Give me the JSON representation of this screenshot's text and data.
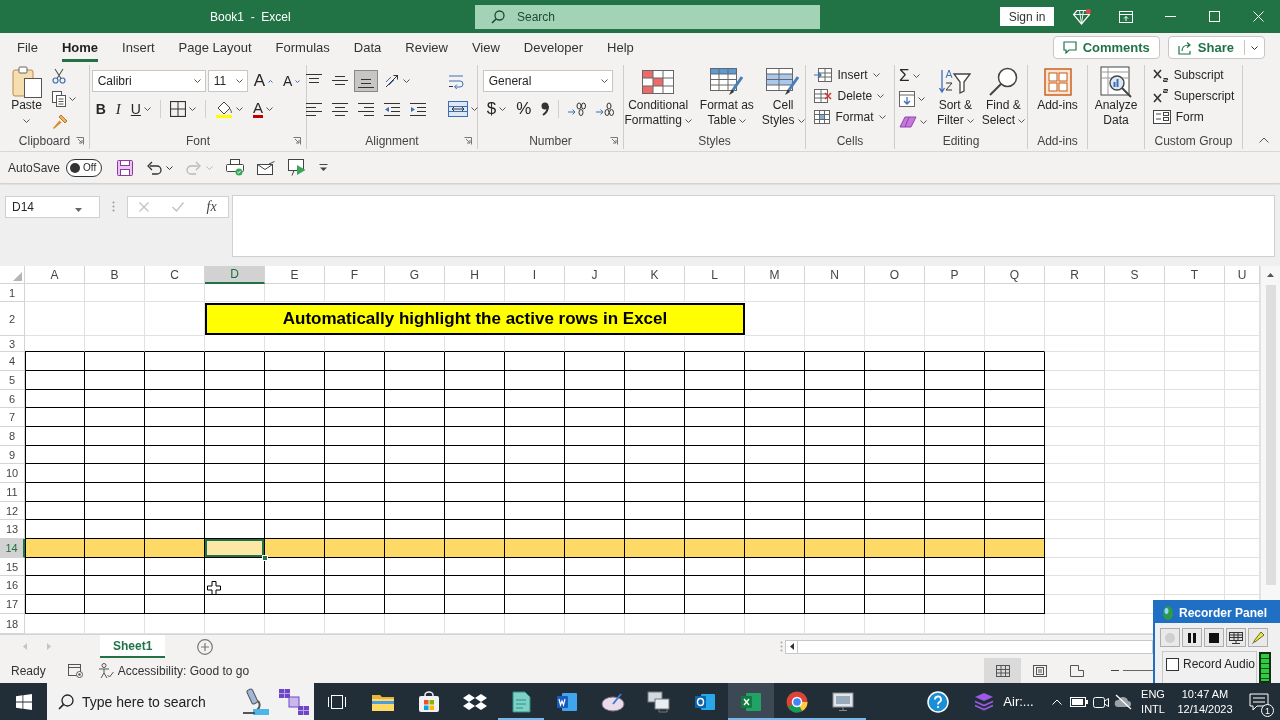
{
  "window": {
    "title": "Book1  -  Excel",
    "search": {
      "placeholder": "Search"
    },
    "sign_in": "Sign in"
  },
  "menu": {
    "tabs": [
      {
        "label": "File",
        "selected": false
      },
      {
        "label": "Home",
        "selected": true
      },
      {
        "label": "Insert",
        "selected": false
      },
      {
        "label": "Page Layout",
        "selected": false
      },
      {
        "label": "Formulas",
        "selected": false
      },
      {
        "label": "Data",
        "selected": false
      },
      {
        "label": "Review",
        "selected": false
      },
      {
        "label": "View",
        "selected": false
      },
      {
        "label": "Developer",
        "selected": false
      },
      {
        "label": "Help",
        "selected": false
      }
    ],
    "comments": "Comments",
    "share": "Share"
  },
  "ribbon": {
    "groups": [
      {
        "label": "Clipboard",
        "launcher": true,
        "items": [
          {
            "kind": "large",
            "lines": [
              "Paste"
            ],
            "dropdown": true
          },
          {
            "kind": "icon",
            "dropdown": false
          },
          {
            "kind": "icon",
            "dropdown": true
          },
          {
            "kind": "icon",
            "dropdown": false
          }
        ]
      },
      {
        "label": "Font",
        "launcher": true,
        "items": [
          {
            "kind": "combo",
            "value": "Calibri",
            "dropdown": true
          },
          {
            "kind": "combo",
            "value": "11",
            "dropdown": true
          },
          {
            "kind": "glyph",
            "label": "A",
            "dropdown": false
          },
          {
            "kind": "glyph",
            "label": "A",
            "dropdown": false
          },
          {
            "kind": "icon",
            "dropdown": true
          },
          {
            "kind": "icon",
            "dropdown": true
          },
          {
            "kind": "glyph",
            "label": "A",
            "dropdown": true
          }
        ],
        "toggles": [
          {
            "label": "B",
            "on": false,
            "dropdown": false
          },
          {
            "label": "I",
            "on": false,
            "dropdown": false
          },
          {
            "label": "U",
            "on": false,
            "dropdown": true
          }
        ]
      },
      {
        "label": "Alignment",
        "launcher": true,
        "items": [
          {
            "kind": "icon",
            "dropdown": true
          },
          {
            "kind": "icon",
            "dropdown": false
          },
          {
            "kind": "icon",
            "dropdown": false
          },
          {
            "kind": "icon",
            "dropdown": false
          },
          {
            "kind": "icon",
            "dropdown": true
          }
        ],
        "toggles": [
          {
            "on": false,
            "dropdown": false
          },
          {
            "on": false,
            "dropdown": false
          },
          {
            "on": true,
            "dropdown": false
          },
          {
            "on": false,
            "dropdown": false
          },
          {
            "on": false,
            "dropdown": false
          },
          {
            "on": false,
            "dropdown": false
          }
        ]
      },
      {
        "label": "Number",
        "launcher": true,
        "items": [
          {
            "kind": "combo",
            "value": "General",
            "dropdown": true
          },
          {
            "kind": "glyph",
            "label": "$",
            "dropdown": true
          },
          {
            "kind": "glyph",
            "label": "%",
            "dropdown": false
          },
          {
            "kind": "icon",
            "dropdown": false
          },
          {
            "kind": "icon",
            "dropdown": false
          },
          {
            "kind": "icon",
            "dropdown": false
          }
        ]
      },
      {
        "label": "Styles",
        "launcher": false,
        "items": [
          {
            "kind": "large",
            "lines": [
              "Conditional",
              "Formatting"
            ],
            "dropdown": true
          },
          {
            "kind": "large",
            "lines": [
              "Format as",
              "Table"
            ],
            "dropdown": true
          },
          {
            "kind": "large",
            "lines": [
              "Cell",
              "Styles"
            ],
            "dropdown": true
          }
        ]
      },
      {
        "label": "Cells",
        "launcher": false,
        "items": [
          {
            "kind": "small",
            "label": "Insert",
            "dropdown": true
          },
          {
            "kind": "small",
            "label": "Delete",
            "dropdown": true
          },
          {
            "kind": "small",
            "label": "Format",
            "dropdown": true
          }
        ]
      },
      {
        "label": "Editing",
        "launcher": false,
        "items": [
          {
            "kind": "glyph",
            "label": "Σ",
            "dropdown": true
          },
          {
            "kind": "icon",
            "dropdown": true
          },
          {
            "kind": "icon",
            "dropdown": true
          },
          {
            "kind": "large",
            "lines": [
              "Sort &",
              "Filter"
            ],
            "dropdown": true
          },
          {
            "kind": "large",
            "lines": [
              "Find &",
              "Select"
            ],
            "dropdown": true
          }
        ]
      },
      {
        "label": "Add-ins",
        "launcher": false,
        "items": [
          {
            "kind": "large",
            "lines": [
              "Add-ins"
            ],
            "dropdown": false
          }
        ]
      },
      {
        "launcher": false,
        "items": [
          {
            "kind": "large",
            "lines": [
              "Analyze",
              "Data"
            ],
            "dropdown": false
          }
        ]
      },
      {
        "label": "Custom Group",
        "launcher": false,
        "items": [
          {
            "kind": "small",
            "label": "Subscript",
            "dropdown": false
          },
          {
            "kind": "small",
            "label": "Superscript",
            "dropdown": false
          },
          {
            "kind": "small",
            "label": "Form",
            "dropdown": false
          }
        ]
      }
    ]
  },
  "quick_access": {
    "autosave": {
      "label": "AutoSave",
      "state": "Off",
      "on": false
    },
    "history": [
      {
        "disabled": false
      },
      {
        "disabled": true
      }
    ]
  },
  "formula_bar": {
    "name_box": "D14",
    "function_label": "fx",
    "editing": false
  },
  "sheet": {
    "columns": [
      {
        "label": "A",
        "selected": false,
        "in_table": true
      },
      {
        "label": "B",
        "selected": false,
        "in_table": true
      },
      {
        "label": "C",
        "selected": false,
        "in_table": true
      },
      {
        "label": "D",
        "selected": true,
        "in_table": true
      },
      {
        "label": "E",
        "selected": false,
        "in_table": true
      },
      {
        "label": "F",
        "selected": false,
        "in_table": true
      },
      {
        "label": "G",
        "selected": false,
        "in_table": true
      },
      {
        "label": "H",
        "selected": false,
        "in_table": true
      },
      {
        "label": "I",
        "selected": false,
        "in_table": true
      },
      {
        "label": "J",
        "selected": false,
        "in_table": true
      },
      {
        "label": "K",
        "selected": false,
        "in_table": true
      },
      {
        "label": "L",
        "selected": false,
        "in_table": true
      },
      {
        "label": "M",
        "selected": false,
        "in_table": true
      },
      {
        "label": "N",
        "selected": false,
        "in_table": true
      },
      {
        "label": "O",
        "selected": false,
        "in_table": true
      },
      {
        "label": "P",
        "selected": false,
        "in_table": true
      },
      {
        "label": "Q",
        "selected": false,
        "in_table": true
      },
      {
        "label": "R",
        "selected": false,
        "in_table": false
      },
      {
        "label": "S",
        "selected": false,
        "in_table": false
      },
      {
        "label": "T",
        "selected": false,
        "in_table": false
      },
      {
        "label": "U",
        "selected": false,
        "in_table": false
      }
    ],
    "rows": [
      {
        "label": "1",
        "selected": false,
        "in_table": false,
        "highlighted": false
      },
      {
        "label": "2",
        "selected": false,
        "in_table": false,
        "highlighted": false
      },
      {
        "label": "3",
        "selected": false,
        "in_table": false,
        "highlighted": false
      },
      {
        "label": "4",
        "selected": false,
        "in_table": true,
        "highlighted": false
      },
      {
        "label": "5",
        "selected": false,
        "in_table": true,
        "highlighted": false
      },
      {
        "label": "6",
        "selected": false,
        "in_table": true,
        "highlighted": false
      },
      {
        "label": "7",
        "selected": false,
        "in_table": true,
        "highlighted": false
      },
      {
        "label": "8",
        "selected": false,
        "in_table": true,
        "highlighted": false
      },
      {
        "label": "9",
        "selected": false,
        "in_table": true,
        "highlighted": false
      },
      {
        "label": "10",
        "selected": false,
        "in_table": true,
        "highlighted": false
      },
      {
        "label": "11",
        "selected": false,
        "in_table": true,
        "highlighted": false
      },
      {
        "label": "12",
        "selected": false,
        "in_table": true,
        "highlighted": false
      },
      {
        "label": "13",
        "selected": false,
        "in_table": true,
        "highlighted": false
      },
      {
        "label": "14",
        "selected": true,
        "in_table": true,
        "highlighted": true
      },
      {
        "label": "15",
        "selected": false,
        "in_table": true,
        "highlighted": false
      },
      {
        "label": "16",
        "selected": false,
        "in_table": true,
        "highlighted": false
      },
      {
        "label": "17",
        "selected": false,
        "in_table": true,
        "highlighted": false
      },
      {
        "label": "18",
        "selected": false,
        "in_table": false,
        "highlighted": false
      }
    ],
    "title": {
      "text": "Automatically highlight the active rows in Excel"
    }
  },
  "sheet_tabs": [
    {
      "label": "Sheet1",
      "selected": true
    }
  ],
  "status_bar": {
    "mode": "Ready",
    "accessibility": "Accessibility: Good to go",
    "views": [
      {
        "selected": true
      },
      {
        "selected": false
      },
      {
        "selected": false
      }
    ]
  },
  "recorder": {
    "title": "Recorder Panel",
    "controls": [
      {
        "disabled": true
      },
      {
        "disabled": false
      },
      {
        "disabled": false
      },
      {
        "disabled": false
      },
      {
        "disabled": false
      }
    ],
    "record_audio": {
      "label": "Record Audio",
      "checked": false
    },
    "meter": {
      "level": 1
    }
  },
  "taskbar": {
    "search": {
      "placeholder": "Type here to search"
    },
    "apps": [
      {
        "running": false,
        "active": false
      },
      {
        "running": false,
        "active": false
      },
      {
        "running": false,
        "active": false
      },
      {
        "running": true,
        "active": false
      },
      {
        "running": false,
        "active": false
      },
      {
        "running": false,
        "active": false
      },
      {
        "running": false,
        "active": false
      },
      {
        "running": false,
        "active": false
      },
      {
        "running": true,
        "active": true
      },
      {
        "running": true,
        "active": false
      },
      {
        "running": true,
        "active": false
      }
    ],
    "tray_app": {
      "label": "Air:..."
    },
    "language": [
      "ENG",
      "INTL"
    ],
    "time": "10:47 AM",
    "date": "12/14/2023",
    "notifications": "1"
  }
}
